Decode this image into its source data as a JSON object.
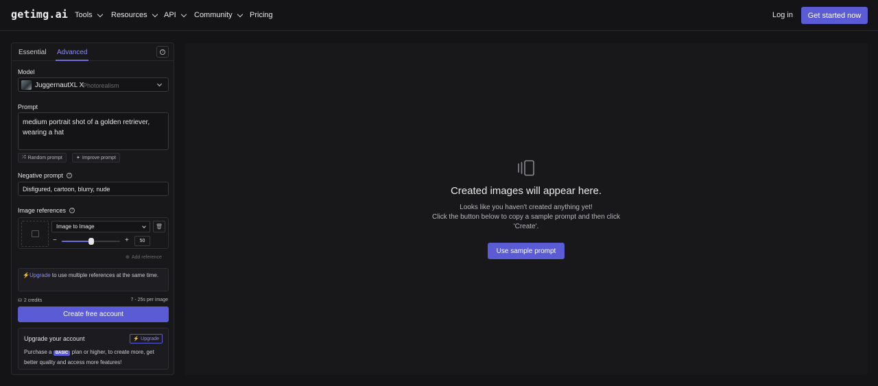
{
  "nav": {
    "logo": "getimg.ai",
    "items": [
      {
        "label": "Tools",
        "icon": "chevron-down-icon"
      },
      {
        "label": "Resources",
        "icon": "chevron-down-icon"
      },
      {
        "label": "API",
        "icon": "chevron-down-icon"
      },
      {
        "label": "Community",
        "icon": "chevron-down-icon"
      },
      {
        "label": "Pricing"
      }
    ],
    "login": "Log in",
    "cta": "Get started now"
  },
  "panel": {
    "tabs": [
      "Essential",
      "Advanced"
    ],
    "active_tab": "Advanced",
    "model": {
      "label": "Model",
      "name": "JuggernautXL X",
      "sub": "Photorealism"
    },
    "prompt": {
      "label": "Prompt",
      "value": "medium portrait shot of a golden retriever, wearing a hat",
      "random": "Random prompt",
      "improve": "Improve prompt"
    },
    "negative": {
      "label": "Negative prompt",
      "value": "Disfigured, cartoon, blurry, nude"
    },
    "refs": {
      "label": "Image references",
      "mode": "Image to Image",
      "strength": "50",
      "strength_fraction": 0.5,
      "add": "Add reference"
    },
    "upsell": {
      "link": "Upgrade",
      "text": " to use multiple references at the same time."
    },
    "credits": "2 credits",
    "time": "7 - 25s per image",
    "create": "Create free account",
    "upgrade_card": {
      "title": "Upgrade your account",
      "button": "Upgrade",
      "text_before": "Purchase a",
      "badge": "BASIC",
      "text_after": "plan or higher, to create more, get better quality and access more features!"
    }
  },
  "stage": {
    "title": "Created images will appear here.",
    "line1": "Looks like you haven't created anything yet!",
    "line2": "Click the button below to copy a sample prompt and then click 'Create'.",
    "button": "Use sample prompt"
  },
  "colors": {
    "accent": "#5b5bd6",
    "accent_text": "#8b8bf0",
    "bg": "#141416"
  }
}
